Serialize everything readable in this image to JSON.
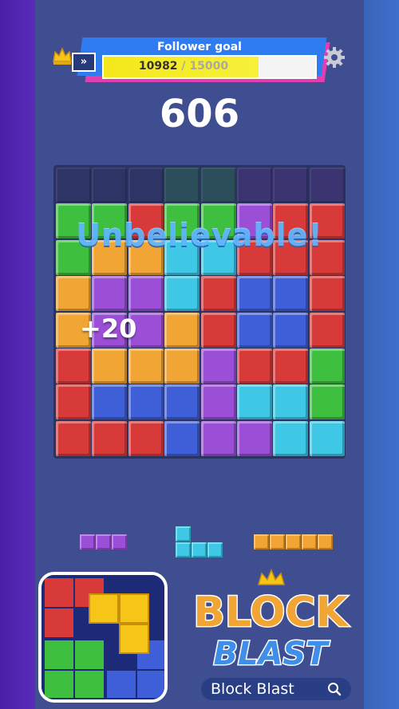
{
  "goal": {
    "title": "Follower goal",
    "current": "10982",
    "separator": " / ",
    "total": "15000",
    "progress_fraction": 0.732,
    "arrow_glyph": "»"
  },
  "score": "606",
  "praise_text": "Unbelievable!",
  "bonus_text": "+20",
  "colors": {
    "red": "#d83a3a",
    "green": "#3fbf3f",
    "blue": "#3f5fd8",
    "purple": "#9a4fd6",
    "orange": "#f0a535",
    "cyan": "#3fc7e6",
    "dark": "#2e3566",
    "darkgreen": "#2c4d5a",
    "darkpurple": "#3a3470"
  },
  "board": [
    [
      "dark",
      "dark",
      "dark",
      "darkgreen",
      "darkgreen",
      "darkpurple",
      "darkpurple",
      "darkpurple"
    ],
    [
      "green",
      "green",
      "red",
      "green",
      "green",
      "purple",
      "red",
      "red"
    ],
    [
      "green",
      "orange",
      "orange",
      "cyan",
      "cyan",
      "red",
      "red",
      "red"
    ],
    [
      "orange",
      "purple",
      "purple",
      "cyan",
      "red",
      "blue",
      "blue",
      "red"
    ],
    [
      "orange",
      "purple",
      "purple",
      "orange",
      "red",
      "blue",
      "blue",
      "red"
    ],
    [
      "red",
      "orange",
      "orange",
      "orange",
      "purple",
      "red",
      "red",
      "green"
    ],
    [
      "red",
      "blue",
      "blue",
      "blue",
      "purple",
      "cyan",
      "cyan",
      "green"
    ],
    [
      "red",
      "red",
      "red",
      "blue",
      "purple",
      "purple",
      "cyan",
      "cyan"
    ]
  ],
  "pieces": [
    {
      "name": "purple-line-3",
      "color": "purple",
      "cells": [
        [
          0,
          0
        ],
        [
          1,
          0
        ],
        [
          2,
          0
        ]
      ]
    },
    {
      "name": "cyan-l-shape",
      "color": "cyan",
      "cells": [
        [
          0,
          0
        ],
        [
          0,
          1
        ],
        [
          1,
          1
        ],
        [
          2,
          1
        ]
      ]
    },
    {
      "name": "orange-line-5",
      "color": "orange",
      "cells": [
        [
          0,
          0
        ],
        [
          1,
          0
        ],
        [
          2,
          0
        ],
        [
          3,
          0
        ],
        [
          4,
          0
        ]
      ]
    }
  ],
  "icons": {
    "crown": "crown-icon",
    "settings": "gear-icon",
    "search": "search-icon"
  },
  "logo": {
    "line1": "BLOCK",
    "line2": "BLAST"
  },
  "search": {
    "label": "Block Blast"
  }
}
